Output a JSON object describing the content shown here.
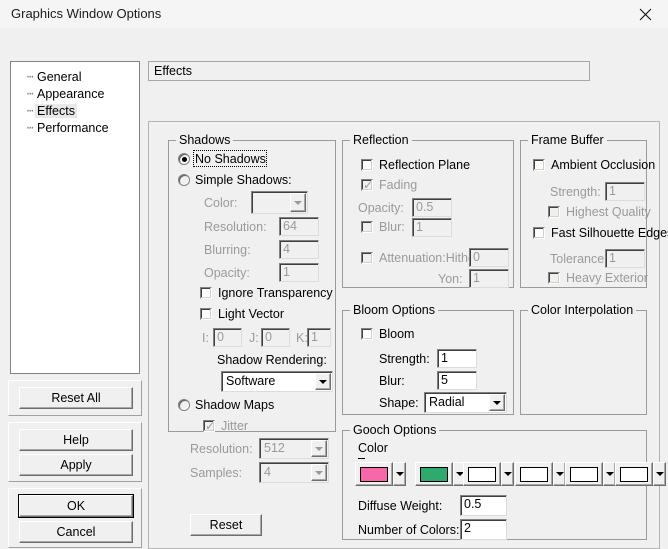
{
  "window": {
    "title": "Graphics Window Options",
    "close_icon": "close-icon"
  },
  "tree": {
    "items": [
      {
        "label": "General",
        "selected": false
      },
      {
        "label": "Appearance",
        "selected": false
      },
      {
        "label": "Effects",
        "selected": true
      },
      {
        "label": "Performance",
        "selected": false
      }
    ]
  },
  "left_buttons": {
    "reset_all": "Reset All",
    "help": "Help",
    "apply": "Apply",
    "ok": "OK",
    "cancel": "Cancel"
  },
  "header": {
    "title": "Effects"
  },
  "shadows": {
    "group_title": "Shadows",
    "no_shadows": {
      "label": "No Shadows",
      "selected": true
    },
    "simple_shadows": {
      "label": "Simple Shadows:",
      "selected": false
    },
    "color_label": "Color:",
    "color_value": "",
    "resolution_label": "Resolution:",
    "resolution_value": "64",
    "blurring_label": "Blurring:",
    "blurring_value": "4",
    "opacity_label": "Opacity:",
    "opacity_value": "1",
    "ignore_transparency": {
      "label": "Ignore Transparency",
      "checked": false
    },
    "light_vector": {
      "label": "Light Vector",
      "checked": false
    },
    "i_label": "I:",
    "i_value": "0",
    "j_label": "J:",
    "j_value": "0",
    "k_label": "K:",
    "k_value": "1",
    "shadow_rendering_label": "Shadow Rendering:",
    "shadow_rendering_value": "Software",
    "shadow_maps": {
      "label": "Shadow Maps",
      "selected": false
    },
    "jitter": {
      "label": "Jitter",
      "checked": true
    },
    "sm_resolution_label": "Resolution:",
    "sm_resolution_value": "512",
    "samples_label": "Samples:",
    "samples_value": "4",
    "reset_button": "Reset"
  },
  "reflection": {
    "group_title": "Reflection",
    "reflection_plane": {
      "label": "Reflection Plane",
      "checked": false
    },
    "fading": {
      "label": "Fading",
      "checked": true
    },
    "opacity_label": "Opacity:",
    "opacity_value": "0.5",
    "blur": {
      "label": "Blur:",
      "checked": false
    },
    "blur_value": "1",
    "attenuation": {
      "label": "Attenuation:Hither:",
      "checked": false
    },
    "hither_value": "0",
    "yon_label": "Yon:",
    "yon_value": "1"
  },
  "frame_buffer": {
    "group_title": "Frame Buffer",
    "ambient_occlusion": {
      "label": "Ambient Occlusion",
      "checked": false
    },
    "strength_label": "Strength:",
    "strength_value": "1",
    "highest_quality": {
      "label": "Highest Quality",
      "checked": false
    },
    "fast_silhouette_edges": {
      "label": "Fast Silhouette Edges",
      "checked": false
    },
    "tolerance_label": "Tolerance:",
    "tolerance_value": "1",
    "heavy_exterior": {
      "label": "Heavy Exterior",
      "checked": false
    }
  },
  "bloom": {
    "group_title": "Bloom Options",
    "bloom": {
      "label": "Bloom",
      "checked": false
    },
    "strength_label": "Strength:",
    "strength_value": "1",
    "blur_label": "Blur:",
    "blur_value": "5",
    "shape_label": "Shape:",
    "shape_value": "Radial"
  },
  "color_interpolation": {
    "group_title": "Color Interpolation"
  },
  "gooch": {
    "group_title": "Gooch Options",
    "color_label": "Color",
    "swatches": [
      "#f768a8",
      "#2eaa6e",
      "#ffffff",
      "#ffffff",
      "#ffffff",
      "#ffffff"
    ],
    "diffuse_weight_label": "Diffuse Weight:",
    "diffuse_weight_value": "0.5",
    "number_of_colors_label": "Number of Colors:",
    "number_of_colors_value": "2"
  }
}
